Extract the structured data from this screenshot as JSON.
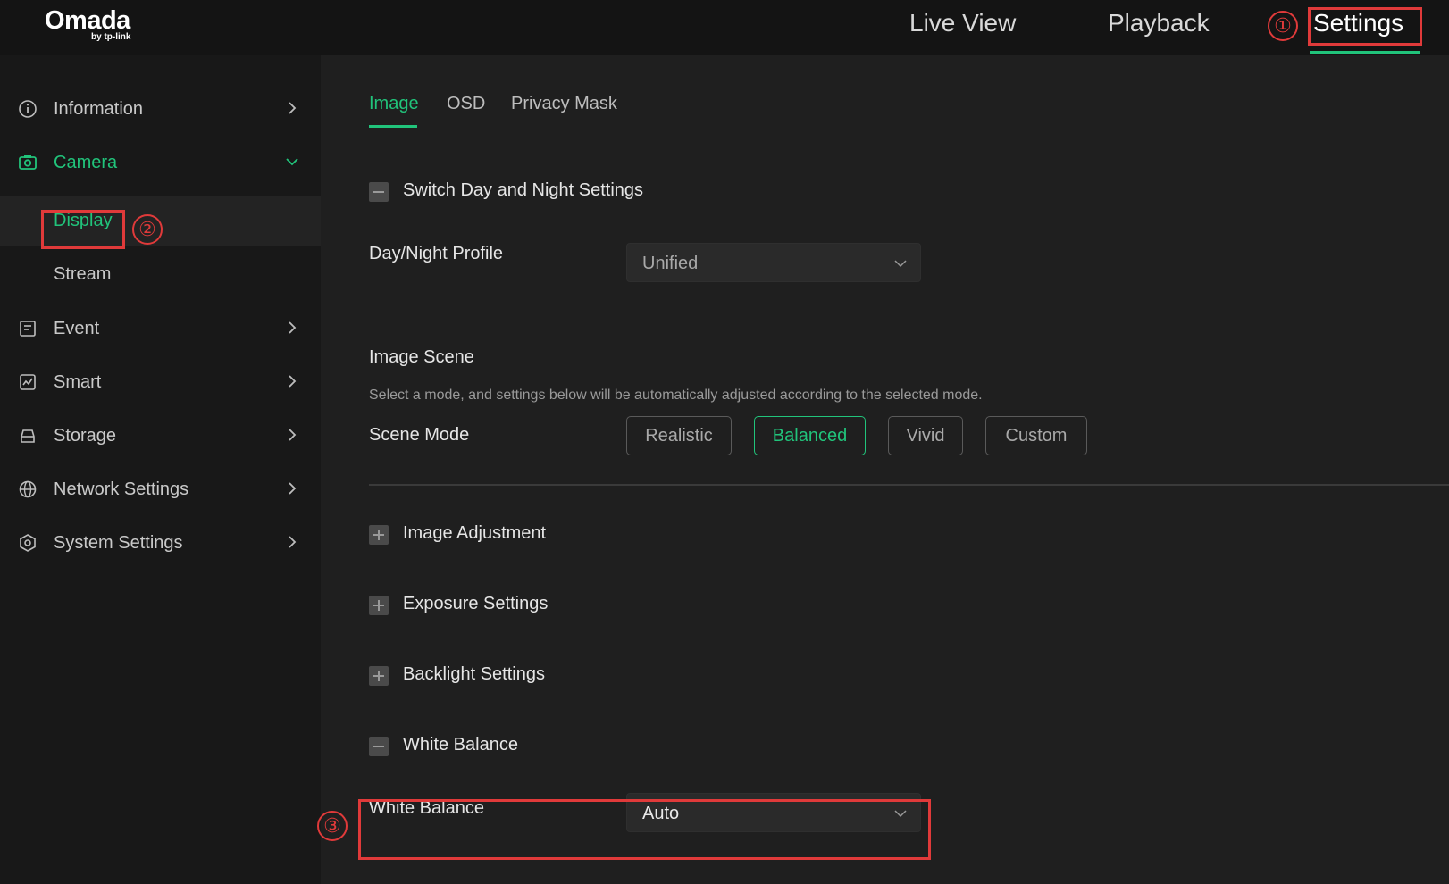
{
  "header": {
    "logo_main": "Omada",
    "logo_sub": "by tp-link",
    "nav": [
      "Live View",
      "Playback",
      "Settings"
    ],
    "active_nav": "Settings"
  },
  "sidebar": {
    "items": [
      {
        "label": "Information",
        "icon": "info-icon"
      },
      {
        "label": "Camera",
        "icon": "camera-icon",
        "expanded": true
      },
      {
        "label": "Event",
        "icon": "event-icon"
      },
      {
        "label": "Smart",
        "icon": "smart-icon"
      },
      {
        "label": "Storage",
        "icon": "storage-icon"
      },
      {
        "label": "Network Settings",
        "icon": "globe-icon"
      },
      {
        "label": "System Settings",
        "icon": "system-settings-icon"
      }
    ],
    "camera_sub": [
      "Display",
      "Stream"
    ],
    "active_sub": "Display"
  },
  "tabs": [
    "Image",
    "OSD",
    "Privacy Mask"
  ],
  "active_tab": "Image",
  "main": {
    "switch_day_night": "Switch Day and Night Settings",
    "day_night_label": "Day/Night Profile",
    "day_night_value": "Unified",
    "image_scene_title": "Image Scene",
    "image_scene_hint": "Select a mode, and settings below will be automatically adjusted according to the selected mode.",
    "scene_mode_label": "Scene Mode",
    "scene_modes": [
      "Realistic",
      "Balanced",
      "Vivid",
      "Custom"
    ],
    "scene_mode_selected": "Balanced",
    "sections": [
      "Image Adjustment",
      "Exposure Settings",
      "Backlight Settings",
      "White Balance"
    ],
    "white_balance_label": "White Balance",
    "white_balance_value": "Auto"
  },
  "annotations": [
    "①",
    "②",
    "③"
  ],
  "colors": {
    "accent": "#21c47b",
    "annotation": "#e03a3a",
    "background": "#1f1f1f",
    "sidebar": "#181818",
    "topbar": "#141414"
  }
}
